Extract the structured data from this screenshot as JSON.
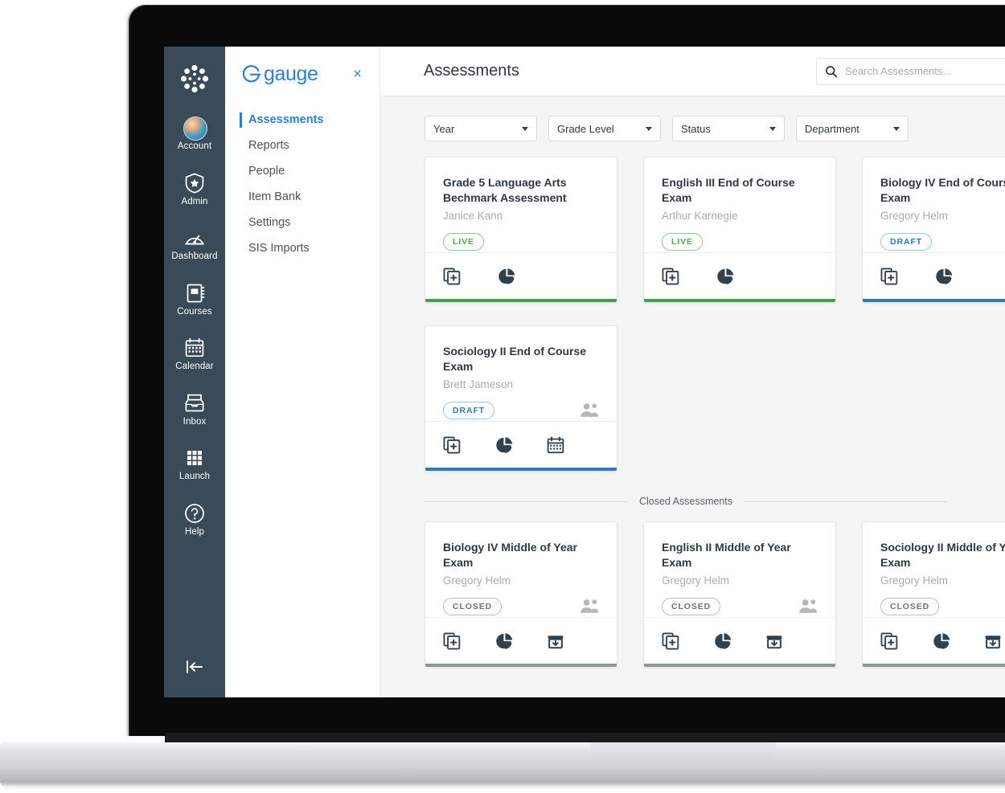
{
  "app": {
    "canvas_logo_icon": "canvas-logo-icon",
    "gauge_wordmark": "gauge",
    "gauge_logo_icon": "gauge-g-icon",
    "close_label": "×"
  },
  "nav_rail": {
    "items": [
      {
        "label": "Account",
        "icon": "user-avatar-icon"
      },
      {
        "label": "Admin",
        "icon": "shield-star-icon"
      },
      {
        "label": "Dashboard",
        "icon": "gauge-dial-icon"
      },
      {
        "label": "Courses",
        "icon": "notebook-icon"
      },
      {
        "label": "Calendar",
        "icon": "calendar-icon"
      },
      {
        "label": "Inbox",
        "icon": "inbox-tray-icon"
      },
      {
        "label": "Launch",
        "icon": "grid-dots-icon"
      },
      {
        "label": "Help",
        "icon": "question-circle-icon"
      }
    ],
    "collapse_icon": "collapse-left-icon"
  },
  "side_menu": {
    "items": [
      {
        "label": "Assessments",
        "active": true
      },
      {
        "label": "Reports",
        "active": false
      },
      {
        "label": "People",
        "active": false
      },
      {
        "label": "Item Bank",
        "active": false
      },
      {
        "label": "Settings",
        "active": false
      },
      {
        "label": "SIS Imports",
        "active": false
      }
    ]
  },
  "header": {
    "title": "Assessments",
    "search_placeholder": "Search Assessments...",
    "search_value": "",
    "search_icon": "search-icon"
  },
  "filters": [
    {
      "label": "Year"
    },
    {
      "label": "Grade Level"
    },
    {
      "label": "Status"
    },
    {
      "label": "Department"
    }
  ],
  "closed_section": {
    "divider_label": "Closed Assessments"
  },
  "colors": {
    "nav_rail_bg": "#394B58",
    "brand_blue": "#2D7FD3",
    "live_green": "#4EA853",
    "draft_blue": "#2B7ABC",
    "closed_gray": "#6E7477",
    "accent_green": "#3EA34A",
    "accent_blue": "#2B7ABC",
    "accent_gray": "#8D949A",
    "page_bg": "#F5F5F5"
  },
  "cards": {
    "active_row_1": [
      {
        "title": "Grade 5 Language Arts Bechmark Assessment",
        "author": "Janice Kann",
        "status": "LIVE",
        "status_class": "live",
        "accent": "green",
        "has_people_icon": false,
        "actions": [
          "duplicate-icon",
          "pie-chart-icon"
        ]
      },
      {
        "title": "English III End of Course Exam",
        "author": "Arthur Karnegie",
        "status": "LIVE",
        "status_class": "live",
        "accent": "green",
        "has_people_icon": false,
        "actions": [
          "duplicate-icon",
          "pie-chart-icon"
        ]
      },
      {
        "title": "Biology IV End of Course Exam",
        "author": "Gregory Helm",
        "status": "DRAFT",
        "status_class": "draft",
        "accent": "blue",
        "has_people_icon": false,
        "actions": [
          "duplicate-icon",
          "pie-chart-icon"
        ]
      }
    ],
    "active_row_2": [
      {
        "title": "Sociology II End of Course Exam",
        "author": "Brett Jameson",
        "status": "DRAFT",
        "status_class": "draft",
        "accent": "blue",
        "has_people_icon": true,
        "actions": [
          "duplicate-icon",
          "pie-chart-icon",
          "calendar-icon"
        ]
      }
    ],
    "closed_row": [
      {
        "title": "Biology IV Middle of Year Exam",
        "author": "Gregory Helm",
        "status": "CLOSED",
        "status_class": "closed",
        "accent": "gray",
        "has_people_icon": true,
        "actions": [
          "duplicate-icon",
          "pie-chart-icon",
          "archive-download-icon"
        ]
      },
      {
        "title": "English II Middle of Year Exam",
        "author": "Gregory Helm",
        "status": "CLOSED",
        "status_class": "closed",
        "accent": "gray",
        "has_people_icon": true,
        "actions": [
          "duplicate-icon",
          "pie-chart-icon",
          "archive-download-icon"
        ]
      },
      {
        "title": "Sociology II Middle of Year Exam",
        "author": "Gregory Helm",
        "status": "CLOSED",
        "status_class": "closed",
        "accent": "gray",
        "has_people_icon": true,
        "actions": [
          "duplicate-icon",
          "pie-chart-icon",
          "archive-download-icon"
        ]
      }
    ]
  }
}
